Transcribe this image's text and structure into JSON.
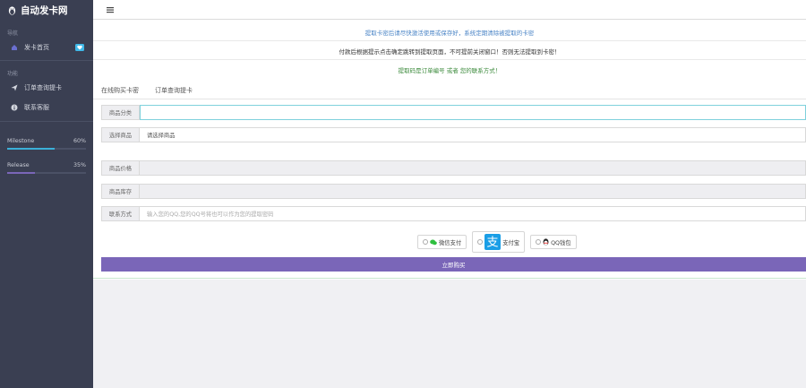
{
  "brand": {
    "title": "自动发卡网",
    "icon": "penguin-icon"
  },
  "sidebar": {
    "section_main": "导航",
    "main_items": [
      {
        "label": "发卡首页",
        "icon": "home-icon"
      }
    ],
    "section_func": "功能",
    "func_items": [
      {
        "label": "订单查询提卡",
        "icon": "send-icon"
      },
      {
        "label": "联系客服",
        "icon": "info-icon"
      }
    ],
    "progress": [
      {
        "label": "Milestone",
        "value_text": "60%",
        "value": 0.6,
        "color": "#3bb0d8"
      },
      {
        "label": "Release",
        "value_text": "35%",
        "value": 0.35,
        "color": "#7a66b8"
      }
    ]
  },
  "topbar": {
    "menu_icon": "menu-icon"
  },
  "notices": [
    {
      "text": "提取卡密后请尽快激活使用或保存好，系统定期清除被提取的卡密",
      "color": "#4a84c6"
    },
    {
      "text": "付款后根据提示点击确定跳转到提取页面，不可提前关闭窗口！否则无法提取到卡密！",
      "color": "#333333"
    },
    {
      "text": "提取码是订单编号 或者 您的联系方式！",
      "color": "#3b8a3b"
    }
  ],
  "tabs": [
    {
      "label": "在线购买卡密"
    },
    {
      "label": "订单查询提卡"
    }
  ],
  "form": {
    "category_label": "商品分类",
    "category_value": "",
    "product_label": "选择商品",
    "product_value": "请选择商品",
    "price_label": "商品价格",
    "price_value": "",
    "stock_label": "商品库存",
    "stock_value": "",
    "contact_label": "联系方式",
    "contact_placeholder": "输入您的QQ,您的QQ号将也可以作为您的提取密码"
  },
  "payments": [
    {
      "label": "微信支付",
      "icon": "wechat-icon"
    },
    {
      "label": "支付宝",
      "icon": "alipay-icon"
    },
    {
      "label": "QQ钱包",
      "icon": "qq-wallet-icon"
    }
  ],
  "buy_label": "立即购买",
  "colors": {
    "sidebar_bg": "#3a3f52",
    "accent_purple": "#7a66b8",
    "accent_cyan": "#3bb0d8"
  }
}
